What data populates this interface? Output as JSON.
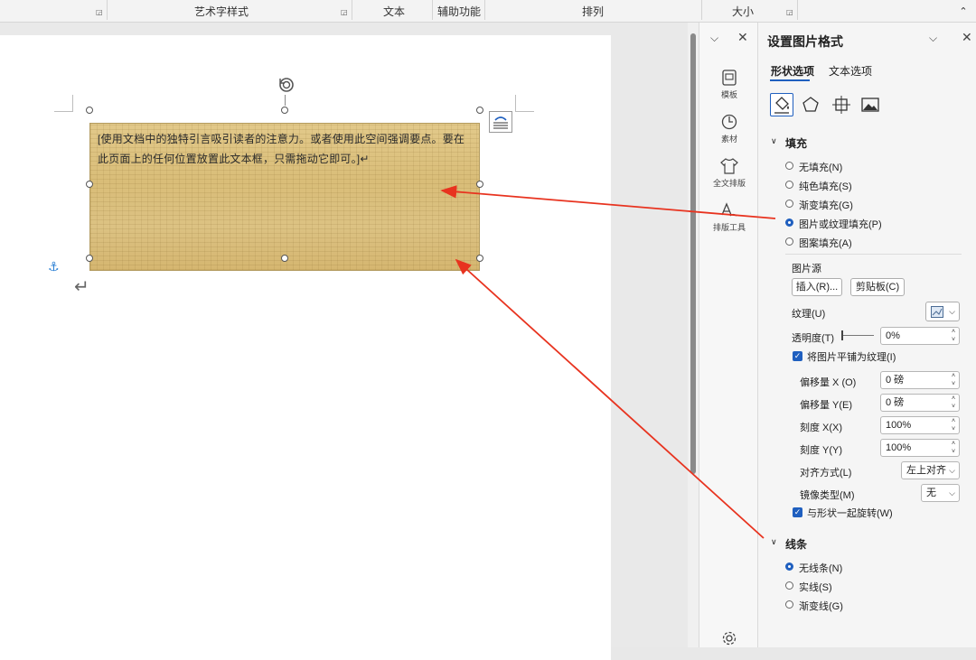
{
  "ribbon": {
    "groups": [
      "艺术字样式",
      "文本",
      "辅助功能",
      "排列",
      "大小"
    ],
    "collapse_glyph": "⌃"
  },
  "document": {
    "textbox_text": "[使用文档中的独特引言吸引读者的注意力。或者使用此空间强调要点。要在此页面上的任何位置放置此文本框，只需拖动它即可。]↵",
    "return_glyph": "↵",
    "anchor_glyph": "⚓",
    "fill_texture": "papyrus"
  },
  "sidebar": {
    "items": [
      {
        "label": "模板",
        "icon": "template-icon"
      },
      {
        "label": "素材",
        "icon": "material-icon"
      },
      {
        "label": "全文排版",
        "icon": "shirt-icon"
      },
      {
        "label": "排版工具",
        "icon": "typeset-tool-icon"
      }
    ]
  },
  "pane": {
    "title": "设置图片格式",
    "tabs": [
      "形状选项",
      "文本选项"
    ],
    "active_tab": 0,
    "fill_section": "填充",
    "fill_options": [
      {
        "label": "无填充(N)",
        "checked": false
      },
      {
        "label": "纯色填充(S)",
        "checked": false
      },
      {
        "label": "渐变填充(G)",
        "checked": false
      },
      {
        "label": "图片或纹理填充(P)",
        "checked": true
      },
      {
        "label": "图案填充(A)",
        "checked": false
      }
    ],
    "picture_source": "图片源",
    "insert_button": "插入(R)...",
    "clipboard_button": "剪贴板(C)",
    "texture_label": "纹理(U)",
    "transparency_label": "透明度(T)",
    "transparency_value": "0%",
    "tile_checkbox": "将图片平铺为纹理(I)",
    "tile_checked": true,
    "offset_x_label": "偏移量 X (O)",
    "offset_x_value": "0 磅",
    "offset_y_label": "偏移量 Y(E)",
    "offset_y_value": "0 磅",
    "scale_x_label": "刻度 X(X)",
    "scale_x_value": "100%",
    "scale_y_label": "刻度 Y(Y)",
    "scale_y_value": "100%",
    "align_label": "对齐方式(L)",
    "align_value": "左上对齐",
    "mirror_label": "镜像类型(M)",
    "mirror_value": "无",
    "rotate_checkbox": "与形状一起旋转(W)",
    "rotate_checked": true,
    "line_section": "线条",
    "line_options": [
      {
        "label": "无线条(N)",
        "checked": true
      },
      {
        "label": "实线(S)",
        "checked": false
      },
      {
        "label": "渐变线(G)",
        "checked": false
      }
    ]
  },
  "colors": {
    "accent": "#1f5fbf",
    "arrow": "#e8331f"
  }
}
